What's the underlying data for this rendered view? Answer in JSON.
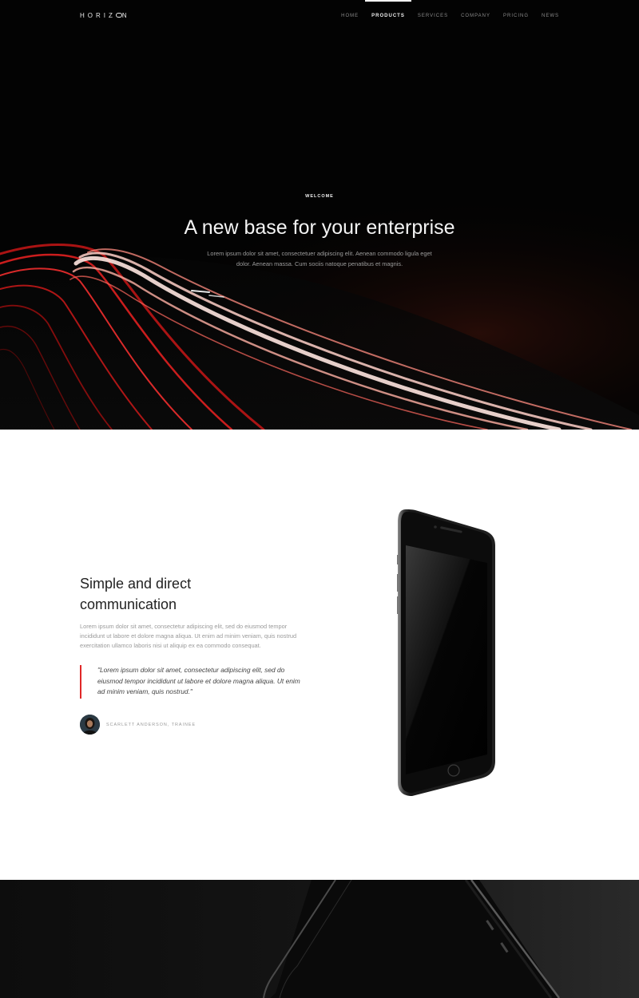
{
  "nav": {
    "logo": "HORIZ",
    "logo_tail": "N",
    "items": [
      {
        "label": "HOME",
        "active": false
      },
      {
        "label": "PRODUCTS",
        "active": true
      },
      {
        "label": "SERVICES",
        "active": false
      },
      {
        "label": "COMPANY",
        "active": false
      },
      {
        "label": "PRICING",
        "active": false
      },
      {
        "label": "NEWS",
        "active": false
      }
    ]
  },
  "hero": {
    "eyebrow": "WELCOME",
    "title": "A new base for your enterprise",
    "subtitle": "Lorem ipsum dolor sit amet, consectetuer adipiscing elit. Aenean commodo ligula eget dolor. Aenean massa. Cum sociis natoque penatibus et magnis."
  },
  "feature": {
    "title": "Simple and direct communication",
    "body": "Lorem ipsum dolor sit amet, consectetur adipiscing elit, sed do eiusmod tempor incididunt ut labore et dolore magna aliqua. Ut enim ad minim veniam, quis nostrud exercitation ullamco laboris nisi ut aliquip ex ea commodo consequat.",
    "quote": "\"Lorem ipsum dolor sit amet, consectetur adipiscing elit, sed do eiusmod tempor incididunt ut labore et dolore magna aliqua. Ut enim ad minim veniam, quis nostrud.\"",
    "author": "SCARLETT ANDERSON, TRAINEE"
  },
  "colors": {
    "accent": "#e02828",
    "hero_bg": "#030303",
    "text_dark": "#222222",
    "text_muted": "#9a9a9a"
  }
}
